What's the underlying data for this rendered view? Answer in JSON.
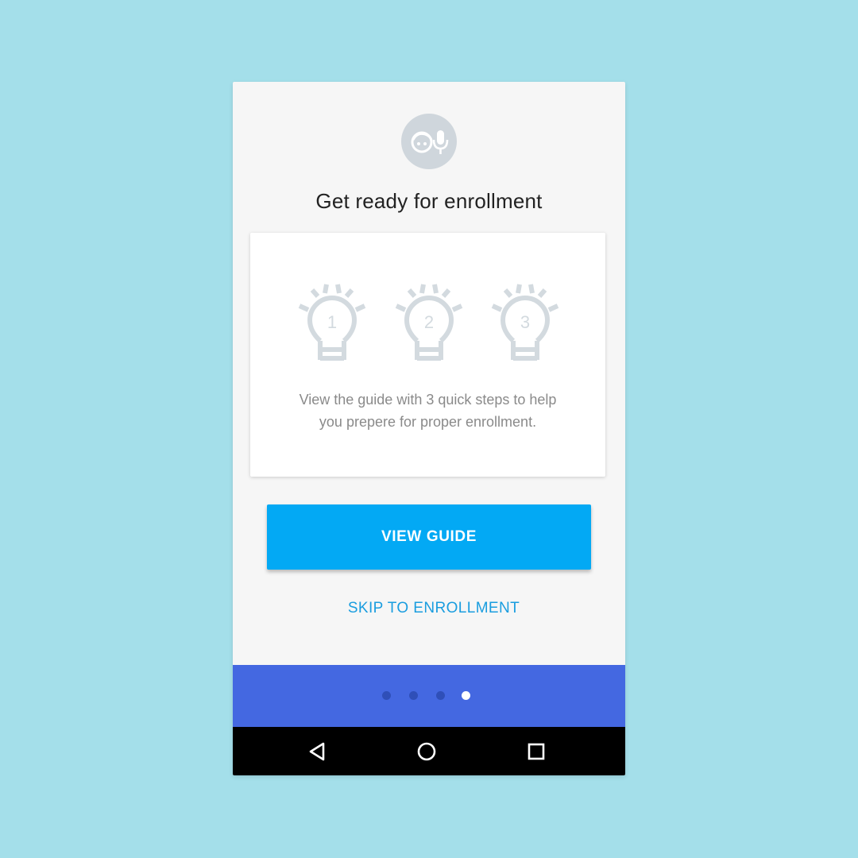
{
  "colors": {
    "background": "#a4dfea",
    "screen": "#f6f6f6",
    "card": "#ffffff",
    "accent": "#03a9f4",
    "link": "#1a9ddf",
    "footer": "#4468e1",
    "icon_grey": "#cfd6dc",
    "navbar": "#000000"
  },
  "header": {
    "icon": "face-and-microphone-icon",
    "title": "Get ready for enrollment"
  },
  "card": {
    "steps": [
      {
        "icon": "lightbulb-icon",
        "number": "1"
      },
      {
        "icon": "lightbulb-icon",
        "number": "2"
      },
      {
        "icon": "lightbulb-icon",
        "number": "3"
      }
    ],
    "description_line1": "View the guide with 3 quick steps to help",
    "description_line2": "you prepere for proper enrollment."
  },
  "actions": {
    "primary_label": "VIEW GUIDE",
    "secondary_label": "SKIP TO ENROLLMENT"
  },
  "pager": {
    "total": 4,
    "active_index": 3
  },
  "navbar": {
    "buttons": [
      "back-icon",
      "home-icon",
      "recents-icon"
    ]
  }
}
